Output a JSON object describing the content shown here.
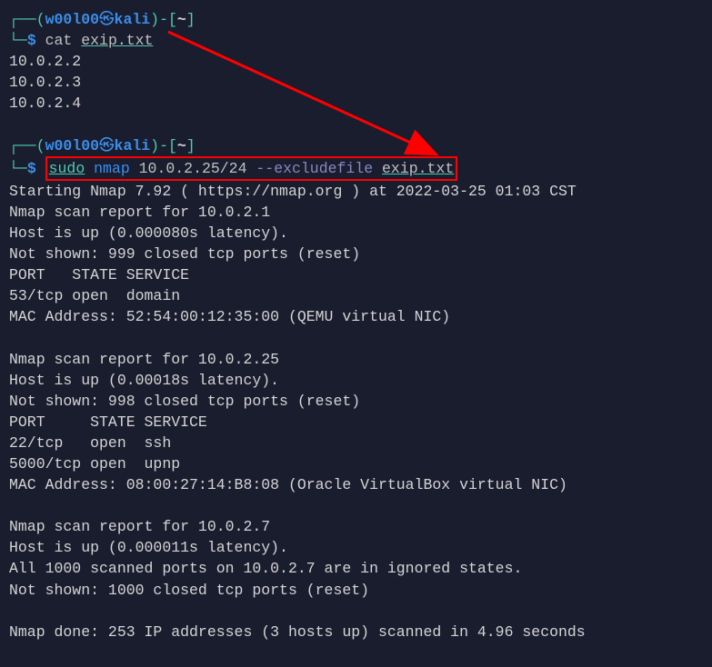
{
  "prompts": {
    "user": "w00l00",
    "host": "kali",
    "path": "~",
    "dollar": "$"
  },
  "cmd1": {
    "cat": "cat",
    "file": "exip.txt"
  },
  "output1": {
    "l1": "10.0.2.2",
    "l2": "10.0.2.3",
    "l3": "10.0.2.4"
  },
  "cmd2": {
    "sudo": "sudo",
    "nmap": "nmap",
    "target": "10.0.2.25/24",
    "flag": "--excludefile",
    "file": "exip.txt"
  },
  "output2": {
    "l1": "Starting Nmap 7.92 ( https://nmap.org ) at 2022-03-25 01:03 CST",
    "l2": "Nmap scan report for 10.0.2.1",
    "l3": "Host is up (0.000080s latency).",
    "l4": "Not shown: 999 closed tcp ports (reset)",
    "l5": "PORT   STATE SERVICE",
    "l6": "53/tcp open  domain",
    "l7": "MAC Address: 52:54:00:12:35:00 (QEMU virtual NIC)",
    "l8": "",
    "l9": "Nmap scan report for 10.0.2.25",
    "l10": "Host is up (0.00018s latency).",
    "l11": "Not shown: 998 closed tcp ports (reset)",
    "l12": "PORT     STATE SERVICE",
    "l13": "22/tcp   open  ssh",
    "l14": "5000/tcp open  upnp",
    "l15": "MAC Address: 08:00:27:14:B8:08 (Oracle VirtualBox virtual NIC)",
    "l16": "",
    "l17": "Nmap scan report for 10.0.2.7",
    "l18": "Host is up (0.000011s latency).",
    "l19": "All 1000 scanned ports on 10.0.2.7 are in ignored states.",
    "l20": "Not shown: 1000 closed tcp ports (reset)",
    "l21": "",
    "l22": "Nmap done: 253 IP addresses (3 hosts up) scanned in 4.96 seconds"
  }
}
